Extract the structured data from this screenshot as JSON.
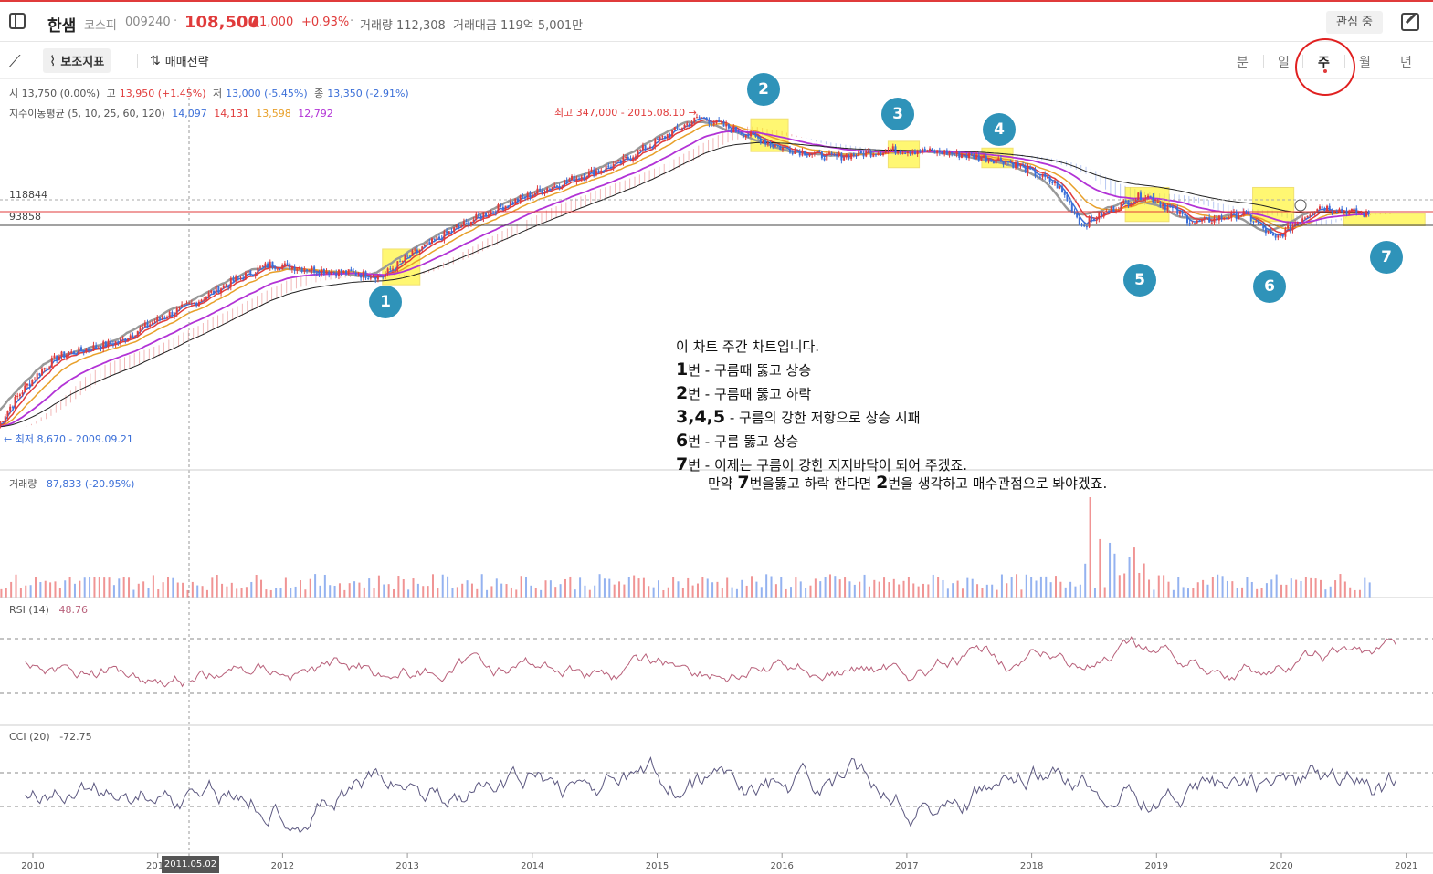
{
  "header": {
    "stock_name": "한샘",
    "market": "코스피",
    "code": "009240",
    "price": "108,500",
    "change": "▲1,000",
    "change_pct": "+0.93%",
    "volume": "거래량 112,308",
    "amount": "거래대금 119억 5,001만",
    "watch_label": "관심 중"
  },
  "toolbar": {
    "indicator_label": "보조지표",
    "strategy_label": "매매전략",
    "periods": [
      "분",
      "일",
      "주",
      "월",
      "년"
    ],
    "active_period": "주"
  },
  "legend": {
    "ohlc": {
      "open": "시 13,750 (0.00%)",
      "high_prefix": "고",
      "high": "13,950 (+1.45%)",
      "low_prefix": "저",
      "low": "13,000 (-5.45%)",
      "close_prefix": "종",
      "close": "13,350 (-2.91%)"
    },
    "ema": {
      "label": "지수이동평균 (5, 10, 25, 60, 120)",
      "v1": "14,097",
      "v2": "14,131",
      "v3": "13,598",
      "v4": "12,792"
    },
    "volume": {
      "label": "거래량",
      "value": "87,833 (-20.95%)"
    },
    "rsi": {
      "label": "RSI (14)",
      "value": "48.76"
    },
    "cci": {
      "label": "CCI (20)",
      "value": "-72.75"
    }
  },
  "price_levels": {
    "upper": "118844",
    "lower": "93858"
  },
  "extremes": {
    "high": "최고 347,000 - 2015.08.10 →",
    "low": "← 최저 8,670 - 2009.09.21"
  },
  "crosshair_date": "2011.05.02",
  "annotation": {
    "line1": "이 차트 주간 차트입니다.",
    "line2_num": "1",
    "line2": "번 - 구름때 뚫고 상승",
    "line3_num": "2",
    "line3": "번 - 구름때 뚫고 하락",
    "line4_num": "3,4,5",
    "line4": " - 구름의 강한 저항으로 상승 시패",
    "line5_num": "6",
    "line5": "번 - 구름 뚫고 상승",
    "line6_num": "7",
    "line6": "번 - 이제는 구름이 강한 지지바닥이 되어 주겠죠.",
    "line7_a": "만약 ",
    "line7_num1": "7",
    "line7_b": "번을뚫고  하락 한다면  ",
    "line7_num2": "2",
    "line7_c": "번을  생각하고 매수관점으로 봐야겠죠."
  },
  "markers": [
    "1",
    "2",
    "3",
    "4",
    "5",
    "6",
    "7"
  ],
  "colors": {
    "up": "#e03b3b",
    "down": "#3b6fd8",
    "ema1": "#3b6fd8",
    "ema2": "#e03b3b",
    "ema3": "#e8a02a",
    "ema4": "#b233d6",
    "ema5": "#222222",
    "highlight": "#fff200",
    "marker": "#2f93b9",
    "rsi": "#b8607a",
    "cci": "#5c5880"
  },
  "chart_data": {
    "type": "line",
    "title": "",
    "x_ticks": [
      "2010",
      "2011",
      "2012",
      "2013",
      "2014",
      "2015",
      "2016",
      "2017",
      "2018",
      "2019",
      "2020",
      "2021"
    ],
    "x": [
      2009.72,
      2010.2,
      2010.7,
      2011.3,
      2011.9,
      2012.3,
      2012.8,
      2013.2,
      2013.7,
      2014.2,
      2014.7,
      2015.0,
      2015.35,
      2015.6,
      2016.0,
      2016.4,
      2016.9,
      2017.3,
      2017.8,
      2018.2,
      2018.4,
      2018.9,
      2019.3,
      2019.7,
      2019.95,
      2020.3,
      2020.7
    ],
    "series": [
      {
        "name": "지수이동평균",
        "values": [
          8670,
          20000,
          24000,
          38000,
          60000,
          56000,
          52000,
          78000,
          115000,
          155000,
          200000,
          260000,
          347000,
          300000,
          240000,
          215000,
          235000,
          228000,
          205000,
          155000,
          95000,
          138000,
          98000,
          110000,
          80000,
          120000,
          108500
        ]
      }
    ],
    "ylim": [
      0,
      380000
    ],
    "price_lines": [
      118844,
      93858
    ]
  }
}
